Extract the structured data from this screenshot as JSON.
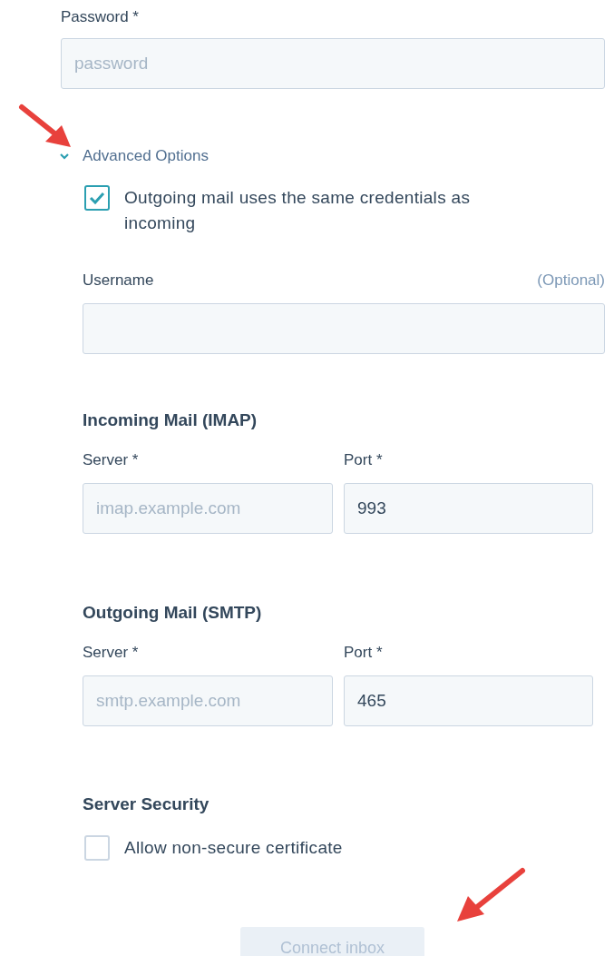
{
  "password": {
    "label": "Password *",
    "placeholder": "password"
  },
  "advanced_options": {
    "label": "Advanced Options",
    "expanded": true,
    "same_credentials": {
      "label": "Outgoing mail uses the same credentials as incoming",
      "checked": true
    },
    "username": {
      "label": "Username",
      "hint": "(Optional)"
    }
  },
  "incoming": {
    "heading": "Incoming Mail (IMAP)",
    "server": {
      "label": "Server *",
      "placeholder": "imap.example.com"
    },
    "port": {
      "label": "Port *",
      "value": "993"
    }
  },
  "outgoing": {
    "heading": "Outgoing Mail (SMTP)",
    "server": {
      "label": "Server *",
      "placeholder": "smtp.example.com"
    },
    "port": {
      "label": "Port *",
      "value": "465"
    }
  },
  "security": {
    "heading": "Server Security",
    "allow_non_secure": {
      "label": "Allow non-secure certificate",
      "checked": false
    }
  },
  "connect_button": {
    "label": "Connect inbox",
    "disabled": true
  }
}
